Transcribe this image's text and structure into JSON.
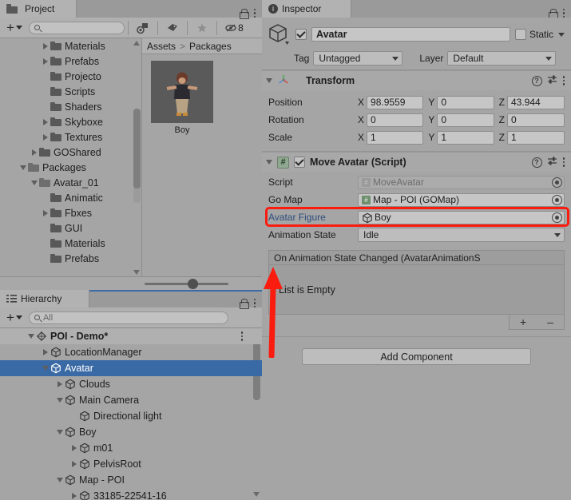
{
  "project_panel": {
    "tab_label": "Project",
    "tab_icon": "folder-icon",
    "toolbar": {
      "create_label": "+",
      "search_placeholder": "",
      "icons": [
        "packages-filter-icon",
        "label-filter-icon",
        "favorites-star-icon",
        "hidden-items-icon"
      ],
      "hidden_count": "8"
    },
    "breadcrumb": {
      "root": "Assets",
      "separator": ">",
      "current": "Packages"
    },
    "asset_grid": [
      {
        "label": "Boy",
        "icon": "prefab-thumbnail"
      }
    ],
    "tree": [
      {
        "label": "Materials",
        "indent": 3,
        "arrow": "right",
        "folder": "closed"
      },
      {
        "label": "Prefabs",
        "indent": 3,
        "arrow": "right",
        "folder": "closed"
      },
      {
        "label": "Projecto",
        "indent": 3,
        "arrow": "none",
        "folder": "closed"
      },
      {
        "label": "Scripts",
        "indent": 3,
        "arrow": "none",
        "folder": "closed"
      },
      {
        "label": "Shaders",
        "indent": 3,
        "arrow": "none",
        "folder": "closed"
      },
      {
        "label": "Skyboxe",
        "indent": 3,
        "arrow": "right",
        "folder": "closed"
      },
      {
        "label": "Textures",
        "indent": 3,
        "arrow": "right",
        "folder": "closed"
      },
      {
        "label": "GOShared",
        "indent": 2,
        "arrow": "right",
        "folder": "closed"
      },
      {
        "label": "Packages",
        "indent": 1,
        "arrow": "down",
        "folder": "open"
      },
      {
        "label": "Avatar_01",
        "indent": 2,
        "arrow": "down",
        "folder": "open"
      },
      {
        "label": "Animatic",
        "indent": 3,
        "arrow": "none",
        "folder": "closed"
      },
      {
        "label": "Fbxes",
        "indent": 3,
        "arrow": "right",
        "folder": "closed"
      },
      {
        "label": "GUI",
        "indent": 3,
        "arrow": "none",
        "folder": "closed"
      },
      {
        "label": "Materials",
        "indent": 3,
        "arrow": "none",
        "folder": "closed"
      },
      {
        "label": "Prefabs",
        "indent": 3,
        "arrow": "none",
        "folder": "closed"
      }
    ],
    "zoom_slider": "thumbnail-size-slider"
  },
  "hierarchy_panel": {
    "tab_label": "Hierarchy",
    "tab_icon": "hierarchy-icon",
    "toolbar": {
      "create_label": "+",
      "search_placeholder": "All"
    },
    "rows": [
      {
        "label": "POI - Demo*",
        "indent": 1,
        "arrow": "down",
        "icon": "scene-icon",
        "selected": false,
        "scene": true
      },
      {
        "label": "LocationManager",
        "indent": 2,
        "arrow": "right",
        "icon": "gameobject-icon",
        "selected": false,
        "scene": false
      },
      {
        "label": "Avatar",
        "indent": 2,
        "arrow": "down",
        "icon": "gameobject-icon",
        "selected": true,
        "scene": false
      },
      {
        "label": "Clouds",
        "indent": 3,
        "arrow": "right",
        "icon": "gameobject-icon",
        "selected": false,
        "scene": false
      },
      {
        "label": "Main Camera",
        "indent": 3,
        "arrow": "down",
        "icon": "gameobject-icon",
        "selected": false,
        "scene": false
      },
      {
        "label": "Directional light",
        "indent": 4,
        "arrow": "none",
        "icon": "gameobject-icon",
        "selected": false,
        "scene": false
      },
      {
        "label": "Boy",
        "indent": 3,
        "arrow": "down",
        "icon": "gameobject-icon",
        "selected": false,
        "scene": false
      },
      {
        "label": "m01",
        "indent": 4,
        "arrow": "right",
        "icon": "gameobject-icon",
        "selected": false,
        "scene": false
      },
      {
        "label": "PelvisRoot",
        "indent": 4,
        "arrow": "right",
        "icon": "gameobject-icon",
        "selected": false,
        "scene": false
      },
      {
        "label": "Map - POI",
        "indent": 3,
        "arrow": "down",
        "icon": "gameobject-icon",
        "selected": false,
        "scene": false
      },
      {
        "label": "33185-22541-16",
        "indent": 4,
        "arrow": "right",
        "icon": "gameobject-icon",
        "selected": false,
        "scene": false
      }
    ]
  },
  "inspector": {
    "tab_label": "Inspector",
    "tab_icon": "info-icon",
    "gameobject": {
      "enabled": true,
      "name": "Avatar",
      "static_checked": false,
      "static_label": "Static",
      "tag_label": "Tag",
      "tag_value": "Untagged",
      "layer_label": "Layer",
      "layer_value": "Default"
    },
    "transform": {
      "title": "Transform",
      "icon": "transform-icon",
      "rows": [
        {
          "label": "Position",
          "x": "98.9559",
          "y": "0",
          "z": "43.944"
        },
        {
          "label": "Rotation",
          "x": "0",
          "y": "0",
          "z": "0"
        },
        {
          "label": "Scale",
          "x": "1",
          "y": "1",
          "z": "1"
        }
      ],
      "axis_labels": [
        "X",
        "Y",
        "Z"
      ]
    },
    "move_avatar": {
      "title": "Move Avatar (Script)",
      "icon": "csharp-script-icon",
      "enabled": true,
      "fields": [
        {
          "label": "Script",
          "value": "MoveAvatar",
          "kind": "object",
          "disabled": true,
          "icon": "script-icon"
        },
        {
          "label": "Go Map",
          "value": "Map - POI (GOMap)",
          "kind": "object",
          "disabled": false,
          "icon": "script-icon"
        },
        {
          "label": "Avatar Figure",
          "value": "Boy",
          "kind": "object",
          "disabled": false,
          "icon": "gameobject-icon",
          "highlighted": true
        },
        {
          "label": "Animation State",
          "value": "Idle",
          "kind": "enum"
        }
      ],
      "event": {
        "title": "On Animation State Changed (AvatarAnimationS",
        "empty_text": "List is Empty",
        "add_label": "+",
        "remove_label": "–"
      }
    },
    "add_component_label": "Add Component"
  },
  "annotation": {
    "highlight_color": "#fb1c10",
    "arrow": "upward-arrow-to-avatar-figure"
  },
  "colors": {
    "panel_bg": "#a5a5a5",
    "selection_blue": "#3a6aa5",
    "field_bg": "#c6c6c6",
    "accent_red": "#fb1c10"
  }
}
